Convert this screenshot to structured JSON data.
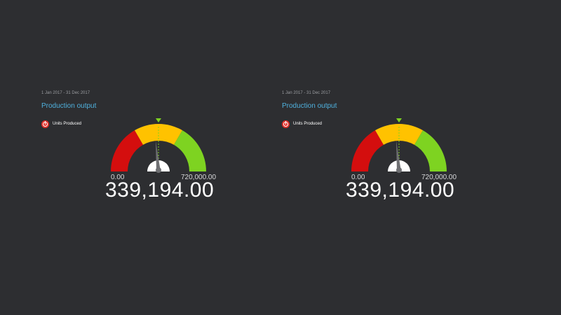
{
  "widgets": [
    {
      "date_range": "1 Jan 2017 - 31 Dec 2017",
      "title": "Production output",
      "legend": {
        "icon": "target-icon",
        "label": "Units Produced",
        "color": "#e0302a"
      },
      "gauge": {
        "min_label": "0.00",
        "max_label": "720,000.00",
        "value_label": "339,194.00",
        "min": 0,
        "max": 720000,
        "value": 339194,
        "target": 360000,
        "bands": [
          {
            "from": 0,
            "to": 240000,
            "color": "#d40e0e"
          },
          {
            "from": 240000,
            "to": 480000,
            "color": "#ffc200"
          },
          {
            "from": 480000,
            "to": 720000,
            "color": "#7ed321"
          }
        ]
      }
    },
    {
      "date_range": "1 Jan 2017 - 31 Dec 2017",
      "title": "Production output",
      "legend": {
        "icon": "target-icon",
        "label": "Units Produced",
        "color": "#e0302a"
      },
      "gauge": {
        "min_label": "0.00",
        "max_label": "720,000.00",
        "value_label": "339,194.00",
        "min": 0,
        "max": 720000,
        "value": 339194,
        "target": 360000,
        "bands": [
          {
            "from": 0,
            "to": 240000,
            "color": "#d40e0e"
          },
          {
            "from": 240000,
            "to": 480000,
            "color": "#ffc200"
          },
          {
            "from": 480000,
            "to": 720000,
            "color": "#7ed321"
          }
        ]
      }
    }
  ]
}
